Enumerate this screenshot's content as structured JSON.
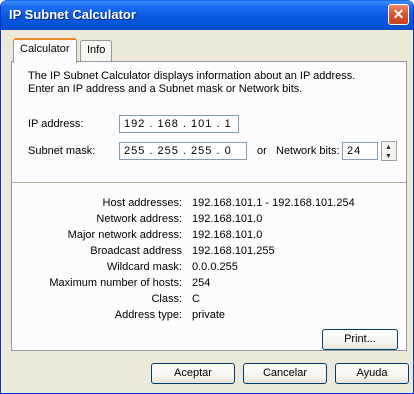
{
  "window": {
    "title": "IP Subnet Calculator",
    "close_glyph": "✕"
  },
  "tabs": [
    {
      "label": "Calculator"
    },
    {
      "label": "Info"
    }
  ],
  "description": {
    "line1": "The IP Subnet Calculator displays information about an IP address.",
    "line2": "Enter an IP address and a Subnet mask or Network bits."
  },
  "form": {
    "ip_label": "IP address:",
    "ip_value": "192 . 168 . 101 .   1",
    "mask_label": "Subnet mask:",
    "mask_value": "255 . 255 . 255 .   0",
    "or_text": "or",
    "bits_label": "Network bits:",
    "bits_value": "24"
  },
  "results": [
    {
      "label": "Host addresses:",
      "value": "192.168.101.1 - 192.168.101.254"
    },
    {
      "label": "Network address:",
      "value": "192.168.101.0"
    },
    {
      "label": "Major network address:",
      "value": "192.168.101.0"
    },
    {
      "label": "Broadcast address",
      "value": "192.168.101.255"
    },
    {
      "label": "Wildcard mask:",
      "value": "0.0.0.255"
    },
    {
      "label": "Maximum number of hosts:",
      "value": "254"
    },
    {
      "label": "Class:",
      "value": "C"
    },
    {
      "label": "Address type:",
      "value": "private"
    }
  ],
  "buttons": {
    "print": "Print...",
    "accept": "Aceptar",
    "cancel": "Cancelar",
    "help": "Ayuda"
  },
  "colors": {
    "titlebar": "#0a58e0",
    "dialog_bg": "#ece9d8",
    "tab_accent": "#e68b2c"
  }
}
